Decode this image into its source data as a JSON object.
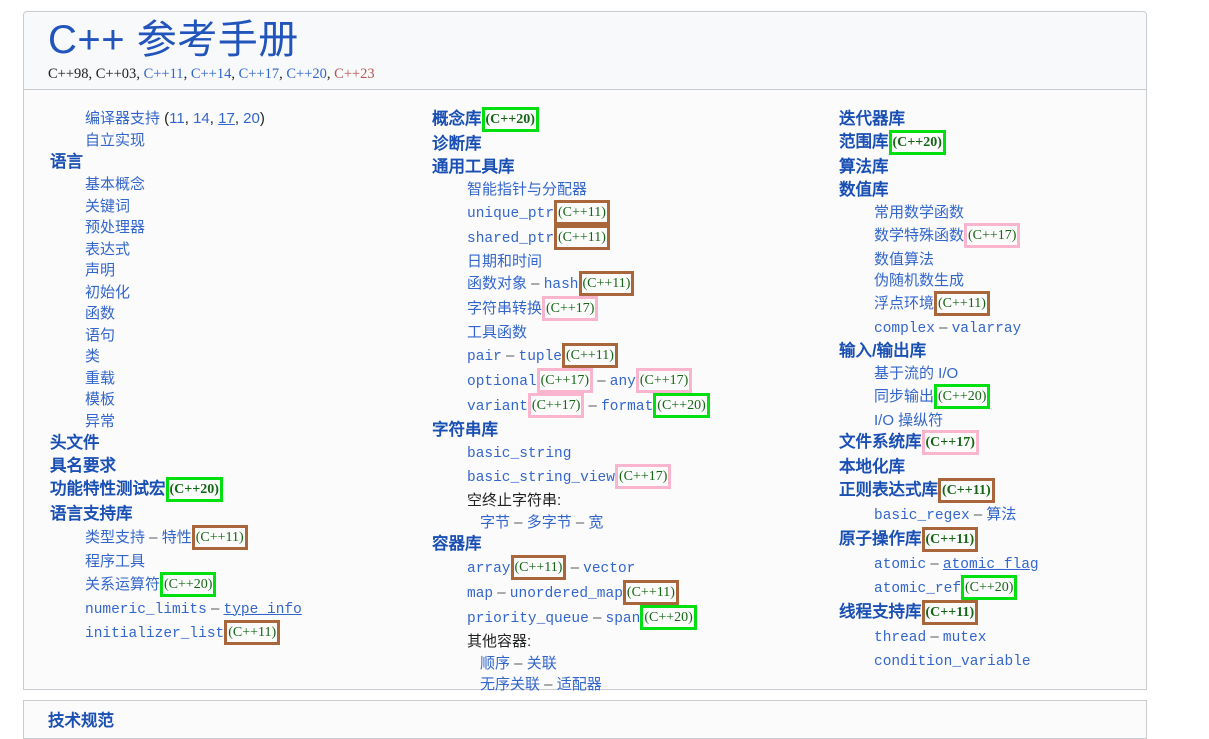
{
  "header": {
    "title": "C++ 参考手册",
    "standards": [
      {
        "label": "C++98",
        "style": "plain"
      },
      {
        "label": "C++03",
        "style": "plain"
      },
      {
        "label": "C++11",
        "style": "link"
      },
      {
        "label": "C++14",
        "style": "link"
      },
      {
        "label": "C++17",
        "style": "link"
      },
      {
        "label": "C++20",
        "style": "link"
      },
      {
        "label": "C++23",
        "style": "new"
      }
    ],
    "separator": ", "
  },
  "colors": {
    "title": "#2255bb",
    "link": "#3366cc",
    "heading": "#1a4fb4",
    "tag_text": "#146614",
    "box_cxx11": "#a9663b",
    "box_cxx17": "#f9b5cd",
    "box_cxx20": "#00e010",
    "new_link": "#b55a50",
    "panel_bg": "#f8f9fa",
    "panel_border": "#c8ccd1"
  },
  "columns": {
    "left": [
      {
        "indent": "sub",
        "parts": [
          {
            "t": "编译器支持 ",
            "k": "link"
          },
          {
            "t": "(",
            "k": "plain"
          },
          {
            "t": "11",
            "k": "link"
          },
          {
            "t": ", ",
            "k": "plain"
          },
          {
            "t": "14",
            "k": "link"
          },
          {
            "t": ", ",
            "k": "plain"
          },
          {
            "t": "17",
            "k": "link-u"
          },
          {
            "t": ", ",
            "k": "plain"
          },
          {
            "t": "20",
            "k": "link"
          },
          {
            "t": ")",
            "k": "plain"
          }
        ]
      },
      {
        "indent": "sub",
        "parts": [
          {
            "t": "自立实现",
            "k": "link"
          }
        ]
      },
      {
        "indent": "hd",
        "parts": [
          {
            "t": "语言",
            "k": "head"
          }
        ]
      },
      {
        "indent": "sub",
        "parts": [
          {
            "t": "基本概念",
            "k": "link"
          }
        ]
      },
      {
        "indent": "sub",
        "parts": [
          {
            "t": "关键词",
            "k": "link"
          }
        ]
      },
      {
        "indent": "sub",
        "parts": [
          {
            "t": "预处理器",
            "k": "link"
          }
        ]
      },
      {
        "indent": "sub",
        "parts": [
          {
            "t": "表达式",
            "k": "link"
          }
        ]
      },
      {
        "indent": "sub",
        "parts": [
          {
            "t": "声明",
            "k": "link"
          }
        ]
      },
      {
        "indent": "sub",
        "parts": [
          {
            "t": "初始化",
            "k": "link"
          }
        ]
      },
      {
        "indent": "sub",
        "parts": [
          {
            "t": "函数",
            "k": "link"
          }
        ]
      },
      {
        "indent": "sub",
        "parts": [
          {
            "t": "语句",
            "k": "link"
          }
        ]
      },
      {
        "indent": "sub",
        "parts": [
          {
            "t": "类",
            "k": "link"
          }
        ]
      },
      {
        "indent": "sub",
        "parts": [
          {
            "t": "重载",
            "k": "link"
          }
        ]
      },
      {
        "indent": "sub",
        "parts": [
          {
            "t": "模板",
            "k": "link"
          }
        ]
      },
      {
        "indent": "sub",
        "parts": [
          {
            "t": "异常",
            "k": "link"
          }
        ]
      },
      {
        "indent": "hd",
        "parts": [
          {
            "t": "头文件",
            "k": "head"
          }
        ]
      },
      {
        "indent": "hd",
        "parts": [
          {
            "t": "具名要求",
            "k": "head"
          }
        ]
      },
      {
        "indent": "hd",
        "parts": [
          {
            "t": "功能特性测试宏",
            "k": "head"
          },
          {
            "t": "(C++20)",
            "k": "tag20"
          }
        ]
      },
      {
        "indent": "hd",
        "parts": [
          {
            "t": "语言支持库",
            "k": "head"
          }
        ]
      },
      {
        "indent": "sub",
        "parts": [
          {
            "t": "类型支持",
            "k": "link"
          },
          {
            "t": " – ",
            "k": "dash"
          },
          {
            "t": " 特性",
            "k": "link"
          },
          {
            "t": "(C++11)",
            "k": "tag11"
          }
        ]
      },
      {
        "indent": "sub",
        "parts": [
          {
            "t": "程序工具",
            "k": "link"
          }
        ]
      },
      {
        "indent": "sub",
        "parts": [
          {
            "t": "关系运算符",
            "k": "link"
          },
          {
            "t": "(C++20)",
            "k": "tag20"
          }
        ]
      },
      {
        "indent": "sub",
        "parts": [
          {
            "t": "numeric_limits",
            "k": "mono"
          },
          {
            "t": " – ",
            "k": "dash"
          },
          {
            "t": "type_info",
            "k": "mono-u"
          }
        ]
      },
      {
        "indent": "sub",
        "parts": [
          {
            "t": "initializer_list",
            "k": "mono"
          },
          {
            "t": "(C++11)",
            "k": "tag11"
          }
        ]
      }
    ],
    "middle": [
      {
        "indent": "hd",
        "parts": [
          {
            "t": "概念库",
            "k": "head"
          },
          {
            "t": "(C++20)",
            "k": "tag20"
          }
        ]
      },
      {
        "indent": "hd",
        "parts": [
          {
            "t": "诊断库",
            "k": "head"
          }
        ]
      },
      {
        "indent": "hd",
        "parts": [
          {
            "t": "通用工具库",
            "k": "head"
          }
        ]
      },
      {
        "indent": "sub",
        "parts": [
          {
            "t": "智能指针与分配器",
            "k": "link"
          }
        ]
      },
      {
        "indent": "sub",
        "parts": [
          {
            "t": " unique_ptr",
            "k": "mono"
          },
          {
            "t": "(C++11)",
            "k": "tag11"
          }
        ]
      },
      {
        "indent": "sub",
        "parts": [
          {
            "t": "shared_ptr",
            "k": "mono"
          },
          {
            "t": " (C++11)",
            "k": "tag11"
          }
        ]
      },
      {
        "indent": "sub",
        "parts": [
          {
            "t": "日期和时间",
            "k": "link"
          }
        ]
      },
      {
        "indent": "sub",
        "parts": [
          {
            "t": "函数对象",
            "k": "link"
          },
          {
            "t": " – ",
            "k": "dash"
          },
          {
            "t": "hash",
            "k": "mono"
          },
          {
            "t": "(C++11)",
            "k": "tag11"
          }
        ]
      },
      {
        "indent": "sub",
        "parts": [
          {
            "t": "字符串转换",
            "k": "link"
          },
          {
            "t": " (C++17)",
            "k": "tag17"
          }
        ]
      },
      {
        "indent": "sub",
        "parts": [
          {
            "t": "工具函数",
            "k": "link"
          }
        ]
      },
      {
        "indent": "sub",
        "parts": [
          {
            "t": "pair",
            "k": "mono"
          },
          {
            "t": " – ",
            "k": "dash"
          },
          {
            "t": "tuple",
            "k": "mono"
          },
          {
            "t": " (C++11)",
            "k": "tag11"
          }
        ]
      },
      {
        "indent": "sub",
        "parts": [
          {
            "t": "optional",
            "k": "mono"
          },
          {
            "t": "(C++17)",
            "k": "tag17"
          },
          {
            "t": " – ",
            "k": "dash"
          },
          {
            "t": "any",
            "k": "mono"
          },
          {
            "t": "(C++17)",
            "k": "tag17"
          }
        ]
      },
      {
        "indent": "sub",
        "parts": [
          {
            "t": "variant",
            "k": "mono"
          },
          {
            "t": "(C++17)",
            "k": "tag17"
          },
          {
            "t": " – ",
            "k": "dash"
          },
          {
            "t": "format",
            "k": "mono"
          },
          {
            "t": "(C++20)",
            "k": "tag20"
          }
        ]
      },
      {
        "indent": "hd",
        "parts": [
          {
            "t": "字符串库",
            "k": "head"
          }
        ]
      },
      {
        "indent": "sub",
        "parts": [
          {
            "t": "basic_string",
            "k": "mono"
          }
        ]
      },
      {
        "indent": "sub",
        "parts": [
          {
            "t": "basic_string_view",
            "k": "mono"
          },
          {
            "t": "(C++17)",
            "k": "tag17"
          }
        ]
      },
      {
        "indent": "sub",
        "parts": [
          {
            "t": "空终止字符串:",
            "k": "plain"
          }
        ]
      },
      {
        "indent": "sub2",
        "parts": [
          {
            "t": "字节",
            "k": "link"
          },
          {
            "t": " – ",
            "k": "dash"
          },
          {
            "t": "多字节",
            "k": "link"
          },
          {
            "t": " – ",
            "k": "dash"
          },
          {
            "t": "宽",
            "k": "link"
          }
        ]
      },
      {
        "indent": "hd",
        "parts": [
          {
            "t": "容器库",
            "k": "head"
          }
        ]
      },
      {
        "indent": "sub",
        "parts": [
          {
            "t": "array",
            "k": "mono"
          },
          {
            "t": "(C++11)",
            "k": "tag11"
          },
          {
            "t": " – ",
            "k": "dash"
          },
          {
            "t": "vector",
            "k": "mono"
          }
        ]
      },
      {
        "indent": "sub",
        "parts": [
          {
            "t": "map",
            "k": "mono"
          },
          {
            "t": " – ",
            "k": "dash"
          },
          {
            "t": "unordered_map",
            "k": "mono"
          },
          {
            "t": " (C++11)",
            "k": "tag11"
          }
        ]
      },
      {
        "indent": "sub",
        "parts": [
          {
            "t": "priority_queue",
            "k": "mono"
          },
          {
            "t": " – ",
            "k": "dash"
          },
          {
            "t": "span",
            "k": "mono"
          },
          {
            "t": "(C++20)",
            "k": "tag20"
          }
        ]
      },
      {
        "indent": "sub",
        "parts": [
          {
            "t": "其他容器:",
            "k": "plain"
          }
        ]
      },
      {
        "indent": "sub2",
        "parts": [
          {
            "t": "顺序",
            "k": "link"
          },
          {
            "t": " – ",
            "k": "dash"
          },
          {
            "t": "关联",
            "k": "link"
          }
        ]
      },
      {
        "indent": "sub2",
        "parts": [
          {
            "t": "无序关联",
            "k": "link"
          },
          {
            "t": " – ",
            "k": "dash"
          },
          {
            "t": "适配器",
            "k": "link"
          }
        ]
      }
    ],
    "right": [
      {
        "indent": "hd",
        "parts": [
          {
            "t": "迭代器库",
            "k": "head"
          }
        ]
      },
      {
        "indent": "hd",
        "parts": [
          {
            "t": "范围库",
            "k": "head"
          },
          {
            "t": " (C++20)",
            "k": "tag20"
          }
        ]
      },
      {
        "indent": "hd",
        "parts": [
          {
            "t": "算法库",
            "k": "head"
          }
        ]
      },
      {
        "indent": "hd",
        "parts": [
          {
            "t": "数值库",
            "k": "head"
          }
        ]
      },
      {
        "indent": "sub",
        "parts": [
          {
            "t": "常用数学函数",
            "k": "link"
          }
        ]
      },
      {
        "indent": "sub",
        "parts": [
          {
            "t": "数学特殊函数",
            "k": "link"
          },
          {
            "t": " (C++17)",
            "k": "tag17"
          }
        ]
      },
      {
        "indent": "sub",
        "parts": [
          {
            "t": "数值算法",
            "k": "link"
          }
        ]
      },
      {
        "indent": "sub",
        "parts": [
          {
            "t": "伪随机数生成",
            "k": "link"
          }
        ]
      },
      {
        "indent": "sub",
        "parts": [
          {
            "t": "浮点环境",
            "k": "link"
          },
          {
            "t": "(C++11)",
            "k": "tag11"
          }
        ]
      },
      {
        "indent": "sub",
        "parts": [
          {
            "t": "complex",
            "k": "mono"
          },
          {
            "t": " – ",
            "k": "dash"
          },
          {
            "t": "valarray",
            "k": "mono"
          }
        ]
      },
      {
        "indent": "hd",
        "parts": [
          {
            "t": "输入/输出库",
            "k": "head"
          }
        ]
      },
      {
        "indent": "sub",
        "parts": [
          {
            "t": "基于流的 I/O",
            "k": "link"
          }
        ]
      },
      {
        "indent": "sub",
        "parts": [
          {
            "t": "同步输出",
            "k": "link"
          },
          {
            "t": " (C++20)",
            "k": "tag20"
          }
        ]
      },
      {
        "indent": "sub",
        "parts": [
          {
            "t": "I/O 操纵符",
            "k": "link"
          }
        ]
      },
      {
        "indent": "hd",
        "parts": [
          {
            "t": "文件系统库",
            "k": "head"
          },
          {
            "t": " (C++17)",
            "k": "tag17"
          }
        ]
      },
      {
        "indent": "hd",
        "parts": [
          {
            "t": "本地化库",
            "k": "head"
          }
        ]
      },
      {
        "indent": "hd",
        "parts": [
          {
            "t": "正则表达式库",
            "k": "head"
          },
          {
            "t": "(C++11)",
            "k": "tag11"
          }
        ]
      },
      {
        "indent": "sub",
        "parts": [
          {
            "t": "basic_regex",
            "k": "mono"
          },
          {
            "t": " – ",
            "k": "dash"
          },
          {
            "t": "算法",
            "k": "link"
          }
        ]
      },
      {
        "indent": "hd",
        "parts": [
          {
            "t": "原子操作库",
            "k": "head"
          },
          {
            "t": " (C++11)",
            "k": "tag11"
          }
        ]
      },
      {
        "indent": "sub",
        "parts": [
          {
            "t": "atomic",
            "k": "mono"
          },
          {
            "t": " – ",
            "k": "dash"
          },
          {
            "t": "atomic_flag",
            "k": "mono-u"
          }
        ]
      },
      {
        "indent": "sub",
        "parts": [
          {
            "t": "atomic_ref",
            "k": "mono"
          },
          {
            "t": "(C++20)",
            "k": "tag20"
          }
        ]
      },
      {
        "indent": "hd",
        "parts": [
          {
            "t": "线程支持库",
            "k": "head"
          },
          {
            "t": "(C++11)",
            "k": "tag11"
          }
        ]
      },
      {
        "indent": "sub",
        "parts": [
          {
            "t": "thread",
            "k": "mono"
          },
          {
            "t": " – ",
            "k": "dash"
          },
          {
            "t": "mutex",
            "k": "mono"
          }
        ]
      },
      {
        "indent": "sub",
        "parts": [
          {
            "t": "condition_variable",
            "k": "mono"
          }
        ]
      }
    ]
  },
  "bottom": {
    "heading": "技术规范"
  }
}
